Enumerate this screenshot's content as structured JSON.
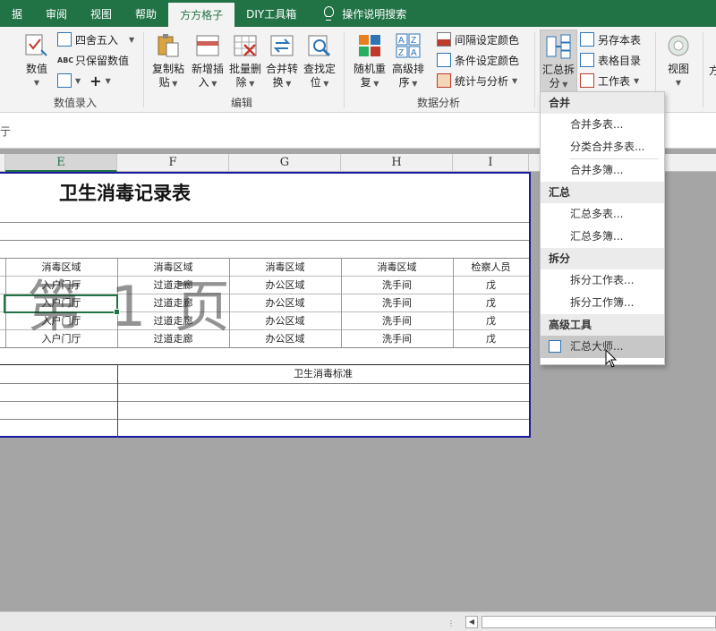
{
  "tabs": [
    "据",
    "审阅",
    "视图",
    "帮助",
    "方方格子",
    "DIY工具箱",
    "操作说明搜索"
  ],
  "active_tab": "方方格子",
  "ribbon": {
    "groups": {
      "data_entry": "数值录入",
      "edit": "编辑",
      "data_analysis": "数据分析"
    },
    "data_entry": {
      "value_btn": "数值",
      "round_btn": "四舍五入",
      "keep_value_btn": "只保留数值",
      "abc_icon_text": "ABC"
    },
    "edit": {
      "copy_paste": [
        "复制粘",
        "贴"
      ],
      "add_insert": [
        "新增插",
        "入"
      ],
      "batch_delete": [
        "批量删",
        "除"
      ],
      "merge_convert": [
        "合并转",
        "换"
      ],
      "find_locate": [
        "查找定",
        "位"
      ]
    },
    "analysis": {
      "random_repeat": [
        "随机重",
        "复"
      ],
      "advanced_sort": [
        "高级排",
        "序"
      ],
      "interval_color": "间隔设定颜色",
      "cond_color": "条件设定颜色",
      "stats": "统计与分析"
    },
    "summary": {
      "summary_split": [
        "汇总拆",
        "分"
      ],
      "save_as_table": "另存本表",
      "table_dir": "表格目录",
      "worksheet": "工作表"
    },
    "view_btn": "视图",
    "clip_text": "方"
  },
  "formula_bar_text": "亍",
  "columns": [
    "E",
    "F",
    "G",
    "H",
    "I"
  ],
  "sheet": {
    "title": "卫生消毒记录表",
    "header_row": [
      "消毒区域",
      "消毒区域",
      "消毒区域",
      "消毒区域",
      "检察人员"
    ],
    "rows": [
      [
        "入户门厅",
        "过道走廊",
        "办公区域",
        "洗手间",
        "戊"
      ],
      [
        "入户门厅",
        "过道走廊",
        "办公区域",
        "洗手间",
        "戊"
      ],
      [
        "入户门厅",
        "过道走廊",
        "办公区域",
        "洗手间",
        "戊"
      ],
      [
        "入户门厅",
        "过道走廊",
        "办公区域",
        "洗手间",
        "戊"
      ]
    ],
    "standard_label": "卫生消毒标准",
    "page_watermark": "第 1 页"
  },
  "menu": [
    {
      "type": "head",
      "label": "合并"
    },
    {
      "type": "item",
      "label": "合并多表..."
    },
    {
      "type": "item",
      "label": "分类合并多表..."
    },
    {
      "type": "sep"
    },
    {
      "type": "item",
      "label": "合并多簿..."
    },
    {
      "type": "head",
      "label": "汇总"
    },
    {
      "type": "item",
      "label": "汇总多表..."
    },
    {
      "type": "item",
      "label": "汇总多簿..."
    },
    {
      "type": "head",
      "label": "拆分"
    },
    {
      "type": "item",
      "label": "拆分工作表..."
    },
    {
      "type": "item",
      "label": "拆分工作簿..."
    },
    {
      "type": "head",
      "label": "高级工具"
    },
    {
      "type": "item",
      "label": "汇总大师...",
      "hover": true
    }
  ],
  "colors": {
    "tab_bar": "#217346",
    "sheet_border": "#1a1a9c",
    "active_cell": "#217346"
  }
}
